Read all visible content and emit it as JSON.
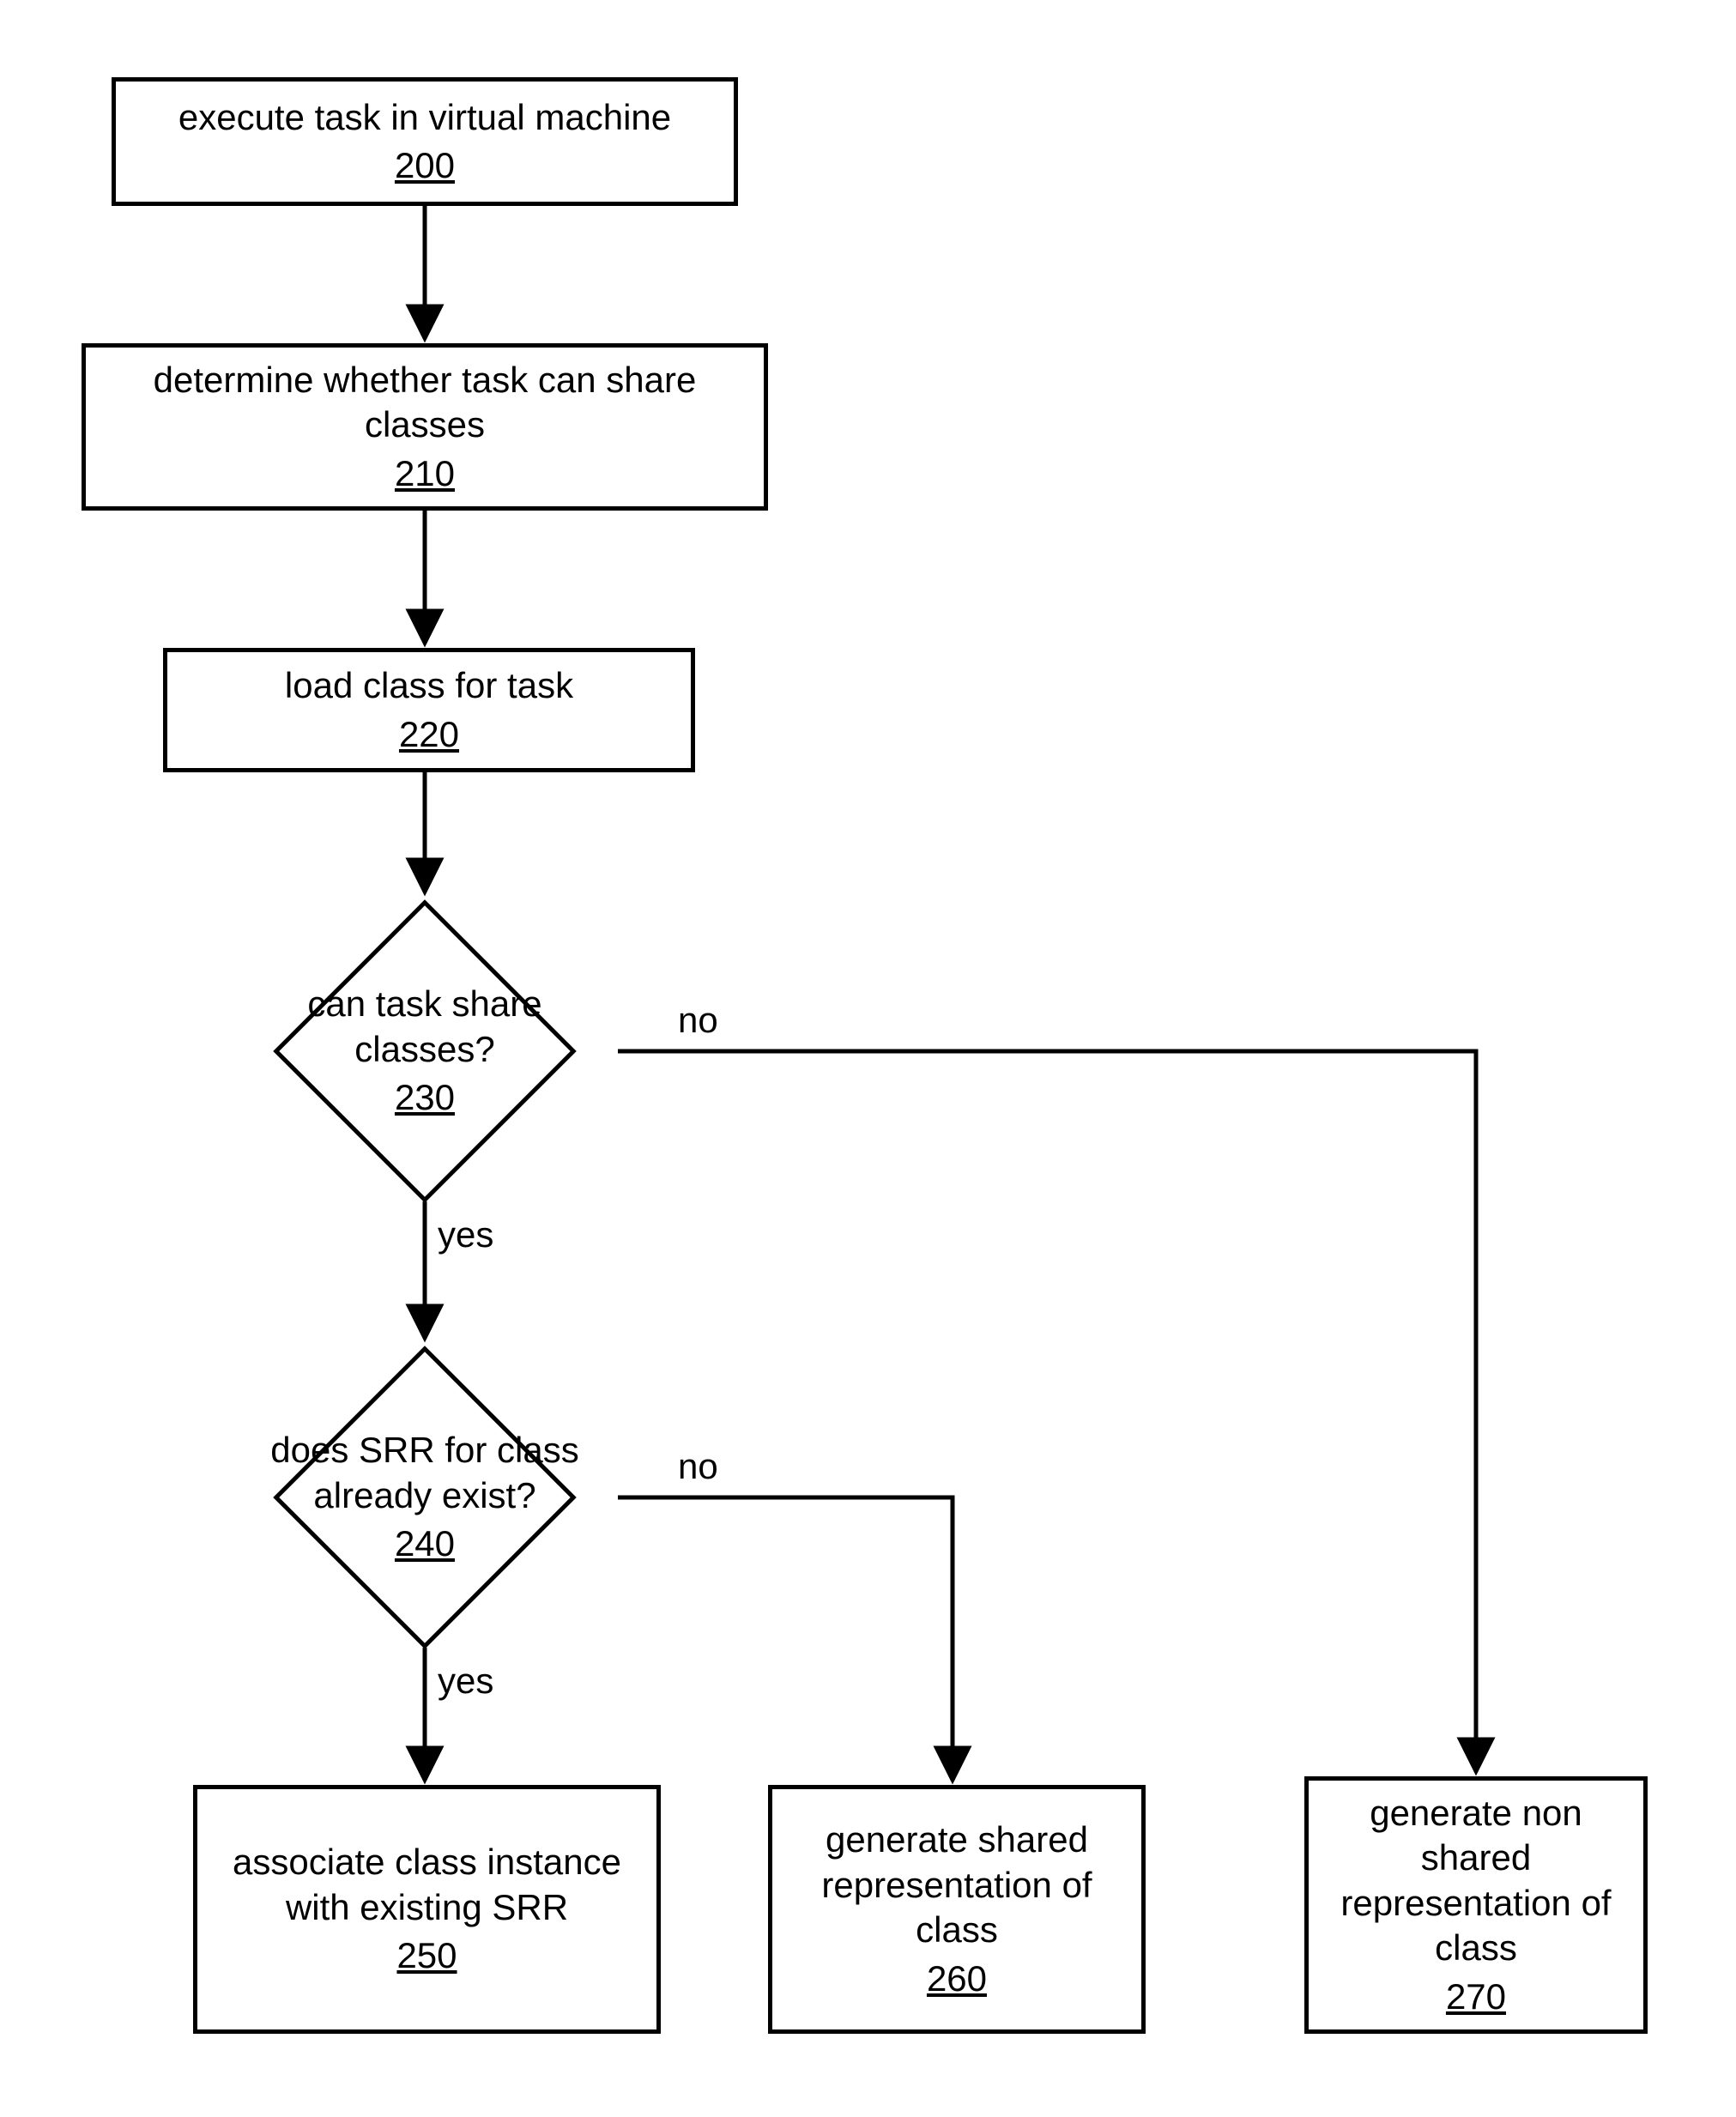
{
  "nodes": {
    "n200": {
      "text": "execute task in virtual machine",
      "ref": "200"
    },
    "n210": {
      "text": "determine whether task can share classes",
      "ref": "210"
    },
    "n220": {
      "text": "load class for task",
      "ref": "220"
    },
    "n230": {
      "text": "can task share classes?",
      "ref": "230"
    },
    "n240": {
      "text": "does SRR for class already exist?",
      "ref": "240"
    },
    "n250": {
      "text": "associate class instance with existing SRR",
      "ref": "250"
    },
    "n260": {
      "text": "generate shared representation of class",
      "ref": "260"
    },
    "n270": {
      "text": "generate non shared representation of class",
      "ref": "270"
    }
  },
  "labels": {
    "yes": "yes",
    "no": "no"
  }
}
